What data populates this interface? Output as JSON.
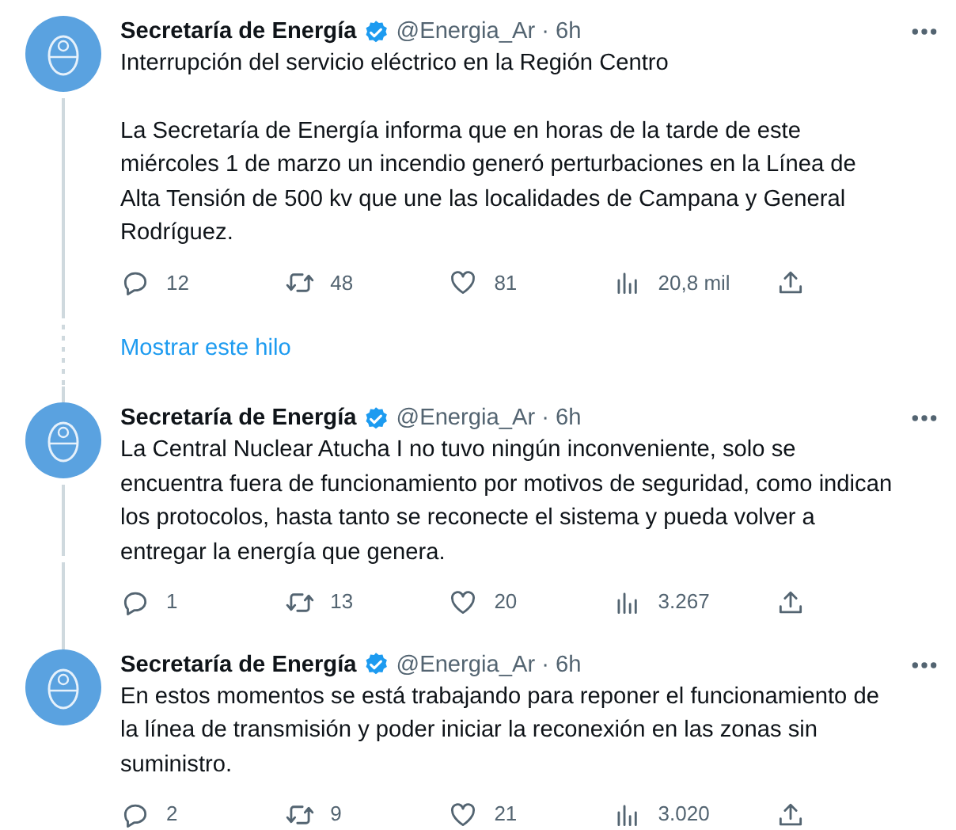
{
  "tweets": [
    {
      "name": "Secretaría de Energía",
      "handle": "@Energia_Ar",
      "separator": "·",
      "time": "6h",
      "paragraphs": [
        "Interrupción del servicio eléctrico en la Región Centro",
        "La Secretaría de Energía informa que en horas de la tarde de este miércoles 1 de marzo un incendio generó perturbaciones en la Línea de Alta Tensión de 500 kv que une las localidades de Campana y General Rodríguez."
      ],
      "replies": "12",
      "retweets": "48",
      "likes": "81",
      "views": "20,8 mil"
    },
    {
      "name": "Secretaría de Energía",
      "handle": "@Energia_Ar",
      "separator": "·",
      "time": "6h",
      "paragraphs": [
        "La Central Nuclear Atucha I no tuvo ningún inconveniente, solo se encuentra fuera de funcionamiento por motivos de seguridad, como indican los protocolos, hasta tanto se reconecte el sistema y pueda volver a entregar la energía que genera."
      ],
      "replies": "1",
      "retweets": "13",
      "likes": "20",
      "views": "3.267"
    },
    {
      "name": "Secretaría de Energía",
      "handle": "@Energia_Ar",
      "separator": "·",
      "time": "6h",
      "paragraphs": [
        "En estos momentos se está trabajando para reponer el funcionamiento de la línea de transmisión y poder iniciar la reconexión en las zonas sin suministro."
      ],
      "replies": "2",
      "retweets": "9",
      "likes": "21",
      "views": "3.020"
    }
  ],
  "show_thread": {
    "label": "Mostrar este hilo"
  }
}
